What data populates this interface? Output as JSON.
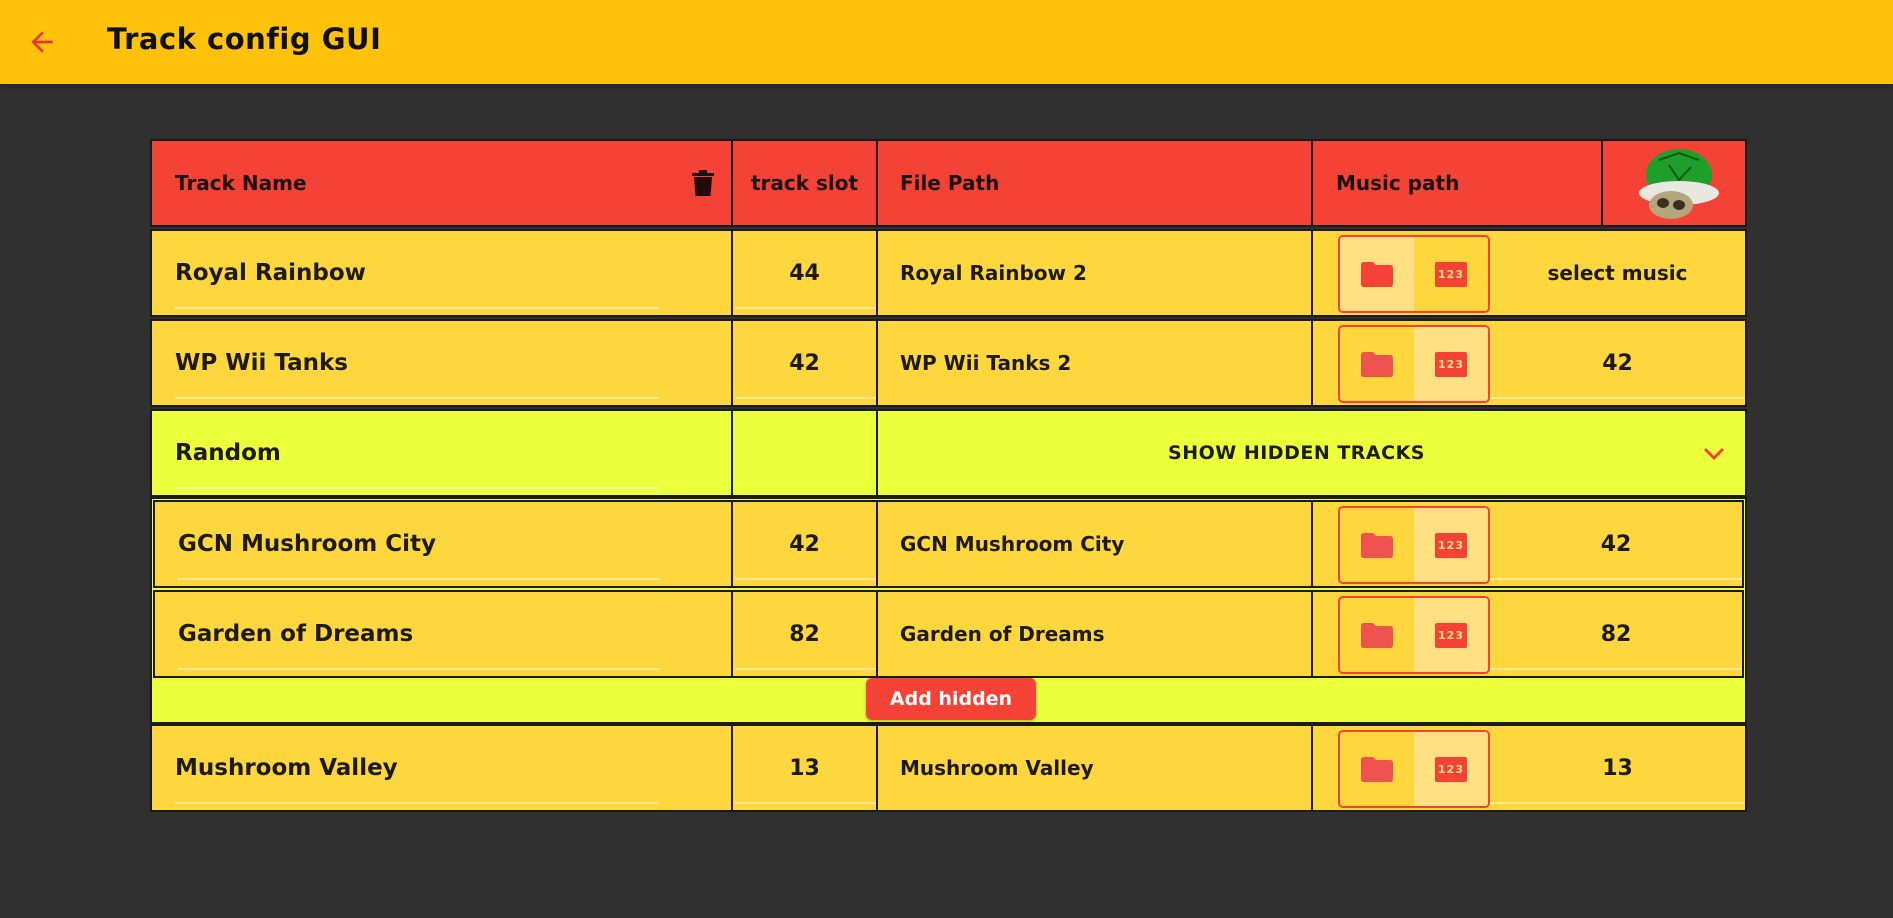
{
  "appbar": {
    "title": "Track config GUI",
    "back_icon": "arrow-left-icon",
    "color": "#ffc20a"
  },
  "table": {
    "header": {
      "track_name": "Track Name",
      "track_slot": "track slot",
      "file_path": "File Path",
      "music_path": "Music path",
      "delete_icon": "trash-icon",
      "image": "green-shell-image"
    },
    "rows": [
      {
        "name": "Royal Rainbow",
        "slot": "44",
        "file": "Royal Rainbow 2",
        "music_mode": "folder",
        "music": "select music"
      },
      {
        "name": "WP Wii Tanks",
        "slot": "42",
        "file": "WP Wii Tanks 2",
        "music_mode": "number",
        "music": "42"
      }
    ],
    "random_row": {
      "name": "Random",
      "slot": "",
      "expander_label": "SHOW HIDDEN TRACKS",
      "expander_icon": "chevron-down-icon"
    },
    "hidden_rows": [
      {
        "name": "GCN Mushroom City",
        "slot": "42",
        "file": "GCN Mushroom City",
        "music_mode": "number",
        "music": "42"
      },
      {
        "name": "Garden of Dreams",
        "slot": "82",
        "file": "Garden of Dreams",
        "music_mode": "number",
        "music": "82"
      }
    ],
    "add_hidden_label": "Add hidden",
    "bottom_rows": [
      {
        "name": "Mushroom Valley",
        "slot": "13",
        "file": "Mushroom Valley",
        "music_mode": "number",
        "music": "13"
      }
    ],
    "toggle": {
      "folder_icon": "folder-icon",
      "number_label": "123"
    }
  },
  "colors": {
    "header_red": "#f44336",
    "row_yellow": "#fed73f",
    "random_lime": "#ebff3b",
    "background": "#303030"
  }
}
